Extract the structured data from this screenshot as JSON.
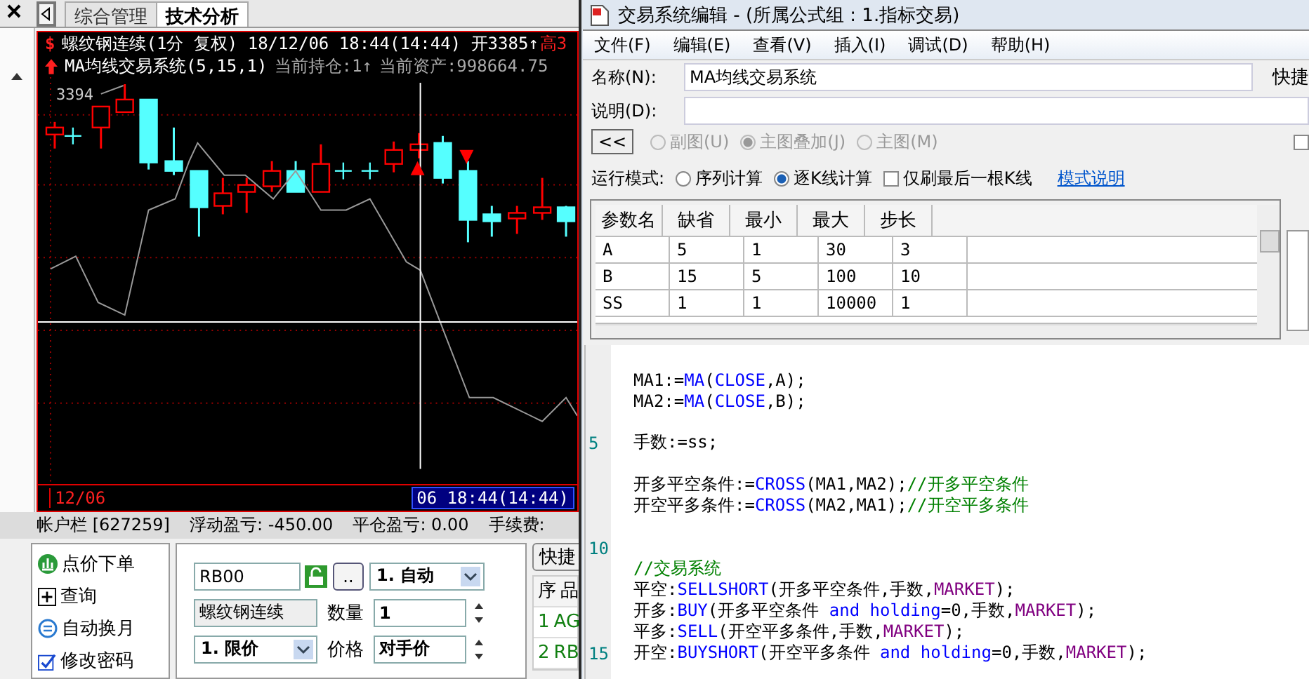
{
  "tabs": [
    {
      "label": "综合管理",
      "selected": false
    },
    {
      "label": "技术分析",
      "selected": true
    }
  ],
  "chart": {
    "marker": "$",
    "symbol_line": "螺纹钢连续(1分 复权) 18/12/06 18:44(14:44) 开3385↑",
    "high_label": "高3",
    "system_label": "MA均线交易系统(5,15,1)",
    "position": "当前持仓:1↑",
    "assets": "当前资产:998664.75",
    "price_label": "3394",
    "date_label": "12/06",
    "cursor_time": "06 18:44(14:44)"
  },
  "account_bar": [
    "帐户栏 [627259]",
    "浮动盈亏: -450.00",
    "平仓盈亏: 0.00",
    "手续费:"
  ],
  "sidebar": [
    {
      "label": "点价下单",
      "kind": "order"
    },
    {
      "label": "查询",
      "kind": "query"
    },
    {
      "label": "自动换月",
      "kind": "rollover"
    },
    {
      "label": "修改密码",
      "kind": "password"
    }
  ],
  "order_form": {
    "contract": "RB00",
    "more_button": "..",
    "strategy": "1. 自动",
    "name": "螺纹钢连续",
    "qty_label": "数量",
    "qty": "1",
    "order_type": "1. 限价",
    "price_label": "价格",
    "price": "对手价"
  },
  "quick_panel": {
    "button": "快捷",
    "columns": [
      "序",
      "品"
    ],
    "rows": [
      [
        "1",
        "AG"
      ],
      [
        "2",
        "RB"
      ]
    ]
  },
  "dialog": {
    "title": "交易系统编辑 - (所属公式组 : 1.指标交易)",
    "menu": [
      "文件(F)",
      "编辑(E)",
      "查看(V)",
      "插入(I)",
      "调试(D)",
      "帮助(H)"
    ],
    "name_label": "名称(N):",
    "name": "MA均线交易系统",
    "hotkey_label": "快捷",
    "desc_label": "说明(D):",
    "collapse_button": "<<",
    "chart_modes": [
      {
        "label": "副图(U)",
        "selected": false,
        "disabled": true
      },
      {
        "label": "主图叠加(J)",
        "selected": true,
        "disabled": true
      },
      {
        "label": "主图(M)",
        "selected": false,
        "disabled": true
      }
    ],
    "side_option": {
      "checked": false
    },
    "run_mode_label": "运行模式:",
    "run_modes": [
      {
        "label": "序列计算",
        "selected": false
      },
      {
        "label": "逐K线计算",
        "selected": true
      }
    ],
    "last_bar_only": {
      "label": "仅刷最后一根K线",
      "checked": false
    },
    "mode_help_link": "模式说明",
    "params": {
      "columns": [
        "参数名",
        "缺省",
        "最小",
        "最大",
        "步长"
      ],
      "rows": [
        [
          "A",
          "5",
          "1",
          "30",
          "3"
        ],
        [
          "B",
          "15",
          "5",
          "100",
          "10"
        ],
        [
          "SS",
          "1",
          "1",
          "10000",
          "1"
        ]
      ]
    },
    "code": [
      {
        "kind": "blank"
      },
      {
        "kind": "code",
        "tokens": [
          {
            "text": "MA1:=",
            "kind": "plain"
          },
          {
            "text": "MA",
            "kind": "func"
          },
          {
            "text": "(",
            "kind": "plain"
          },
          {
            "text": "CLOSE",
            "kind": "func"
          },
          {
            "text": ",A);",
            "kind": "plain"
          }
        ]
      },
      {
        "kind": "code",
        "tokens": [
          {
            "text": "MA2:=",
            "kind": "plain"
          },
          {
            "text": "MA",
            "kind": "func"
          },
          {
            "text": "(",
            "kind": "plain"
          },
          {
            "text": "CLOSE",
            "kind": "func"
          },
          {
            "text": ",B);",
            "kind": "plain"
          }
        ]
      },
      {
        "kind": "blank"
      },
      {
        "kind": "code",
        "number": "5",
        "tokens": [
          {
            "text": "手数:=ss;",
            "kind": "plain"
          }
        ]
      },
      {
        "kind": "blank"
      },
      {
        "kind": "code",
        "tokens": [
          {
            "text": "开多平空条件:=",
            "kind": "plain"
          },
          {
            "text": "CROSS",
            "kind": "func"
          },
          {
            "text": "(MA1,MA2);",
            "kind": "plain"
          },
          {
            "text": "//开多平空条件",
            "kind": "comment"
          }
        ]
      },
      {
        "kind": "code",
        "tokens": [
          {
            "text": "开空平多条件:=",
            "kind": "plain"
          },
          {
            "text": "CROSS",
            "kind": "func"
          },
          {
            "text": "(MA2,MA1);",
            "kind": "plain"
          },
          {
            "text": "//开空平多条件",
            "kind": "comment"
          }
        ]
      },
      {
        "kind": "blank"
      },
      {
        "kind": "blank",
        "number": "10"
      },
      {
        "kind": "code",
        "tokens": [
          {
            "text": "//交易系统",
            "kind": "comment"
          }
        ]
      },
      {
        "kind": "code",
        "tokens": [
          {
            "text": "平空:",
            "kind": "plain"
          },
          {
            "text": "SELLSHORT",
            "kind": "func"
          },
          {
            "text": "(开多平空条件,手数,",
            "kind": "plain"
          },
          {
            "text": "MARKET",
            "kind": "const"
          },
          {
            "text": ");",
            "kind": "plain"
          }
        ]
      },
      {
        "kind": "code",
        "tokens": [
          {
            "text": "开多:",
            "kind": "plain"
          },
          {
            "text": "BUY",
            "kind": "func"
          },
          {
            "text": "(开多平空条件 ",
            "kind": "plain"
          },
          {
            "text": "and holding",
            "kind": "func"
          },
          {
            "text": "=0,手数,",
            "kind": "plain"
          },
          {
            "text": "MARKET",
            "kind": "const"
          },
          {
            "text": ");",
            "kind": "plain"
          }
        ]
      },
      {
        "kind": "code",
        "tokens": [
          {
            "text": "平多:",
            "kind": "plain"
          },
          {
            "text": "SELL",
            "kind": "func"
          },
          {
            "text": "(开空平多条件,手数,",
            "kind": "plain"
          },
          {
            "text": "MARKET",
            "kind": "const"
          },
          {
            "text": ");",
            "kind": "plain"
          }
        ]
      },
      {
        "kind": "code",
        "number": "15",
        "tokens": [
          {
            "text": "开空:",
            "kind": "plain"
          },
          {
            "text": "BUYSHORT",
            "kind": "func"
          },
          {
            "text": "(开空平多条件 ",
            "kind": "plain"
          },
          {
            "text": "and holding",
            "kind": "func"
          },
          {
            "text": "=0,手数,",
            "kind": "plain"
          },
          {
            "text": "MARKET",
            "kind": "const"
          },
          {
            "text": ");",
            "kind": "plain"
          }
        ]
      }
    ]
  }
}
